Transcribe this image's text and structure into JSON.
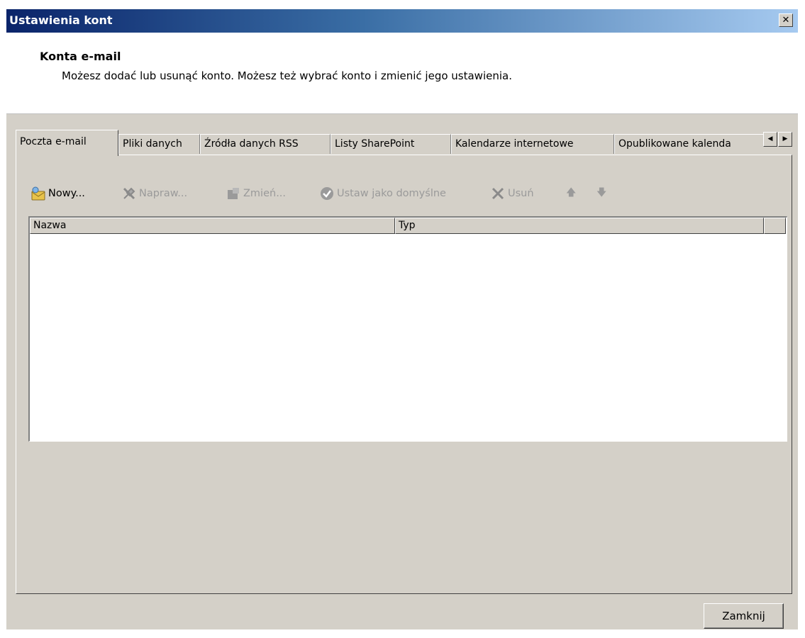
{
  "window": {
    "title": "Ustawienia kont",
    "close_glyph": "✕"
  },
  "header": {
    "title": "Konta e-mail",
    "description": "Możesz dodać lub usunąć konto. Możesz też wybrać konto i zmienić jego ustawienia."
  },
  "tabs": [
    {
      "label": "Poczta e-mail",
      "active": true
    },
    {
      "label": "Pliki danych",
      "active": false
    },
    {
      "label": "Źródła danych RSS",
      "active": false
    },
    {
      "label": "Listy SharePoint",
      "active": false
    },
    {
      "label": "Kalendarze internetowe",
      "active": false
    },
    {
      "label": "Opublikowane kalenda",
      "active": false
    }
  ],
  "tab_scroll": {
    "left_glyph": "◀",
    "right_glyph": "▶"
  },
  "toolbar": {
    "new": {
      "label": "Nowy...",
      "icon": "new-account-icon",
      "enabled": true
    },
    "repair": {
      "label": "Napraw...",
      "icon": "tools-icon",
      "enabled": false
    },
    "change": {
      "label": "Zmień...",
      "icon": "change-icon",
      "enabled": false
    },
    "set_default": {
      "label": "Ustaw jako domyślne",
      "icon": "check-circle-icon",
      "enabled": false
    },
    "remove": {
      "label": "Usuń",
      "icon": "x-icon",
      "enabled": false
    },
    "move_up": {
      "glyph": "🡅",
      "icon": "arrow-up-icon",
      "enabled": false
    },
    "move_down": {
      "glyph": "🡇",
      "icon": "arrow-down-icon",
      "enabled": false
    }
  },
  "list": {
    "columns": [
      "Nazwa",
      "Typ"
    ],
    "rows": []
  },
  "footer": {
    "close_label": "Zamknij"
  }
}
